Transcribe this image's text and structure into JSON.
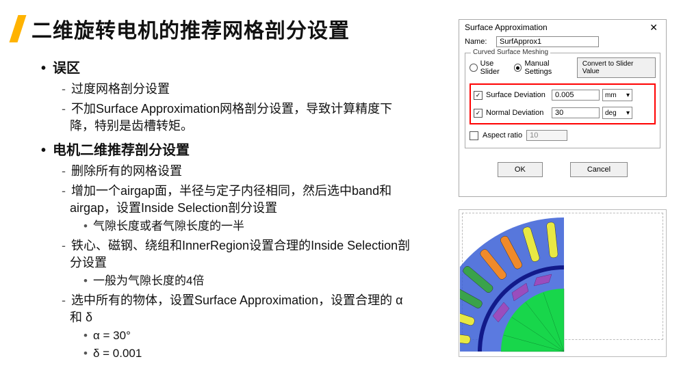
{
  "title": "二维旋转电机的推荐网格剖分设置",
  "bullets": {
    "sec1": {
      "head": "误区",
      "b1": "过度网格剖分设置",
      "b2": "不加Surface Approximation网格剖分设置，导致计算精度下降，特别是齿槽转矩。"
    },
    "sec2": {
      "head": "电机二维推荐剖分设置",
      "b1": "删除所有的网格设置",
      "b2": "增加一个airgap面，半径与定子内径相同，然后选中band和airgap，设置Inside Selection剖分设置",
      "b2a": "气隙长度或者气隙长度的一半",
      "b3": "铁心、磁钢、绕组和InnerRegion设置合理的Inside Selection剖分设置",
      "b3a": "一般为气隙长度的4倍",
      "b4": "选中所有的物体，设置Surface Approximation，设置合理的 α 和 δ",
      "b4a": "α = 30°",
      "b4b": "δ = 0.001"
    }
  },
  "dialog": {
    "title": "Surface Approximation",
    "name_label": "Name:",
    "name_value": "SurfApprox1",
    "fieldset": "Curved Surface Meshing",
    "radio_slider": "Use Slider",
    "radio_manual": "Manual Settings",
    "convert": "Convert to Slider Value",
    "surface_dev_label": "Surface Deviation",
    "surface_dev_value": "0.005",
    "surface_dev_unit": "mm",
    "normal_dev_label": "Normal Deviation",
    "normal_dev_value": "30",
    "normal_dev_unit": "deg",
    "aspect_label": "Aspect ratio",
    "aspect_value": "10",
    "ok": "OK",
    "cancel": "Cancel"
  }
}
